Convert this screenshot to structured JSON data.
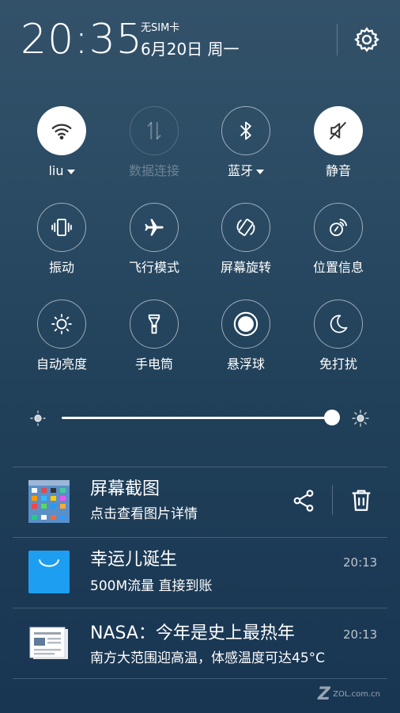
{
  "status": {
    "time": "20:35",
    "sim": "无SIM卡",
    "date": "6月20日 周一"
  },
  "toggles": [
    {
      "label": "liu",
      "icon": "wifi-icon",
      "state": "on",
      "dropdown": true
    },
    {
      "label": "数据连接",
      "icon": "mobile-data-icon",
      "state": "disabled",
      "dropdown": false
    },
    {
      "label": "蓝牙",
      "icon": "bluetooth-icon",
      "state": "off",
      "dropdown": true
    },
    {
      "label": "静音",
      "icon": "mute-icon",
      "state": "on",
      "dropdown": false
    },
    {
      "label": "振动",
      "icon": "vibrate-icon",
      "state": "off"
    },
    {
      "label": "飞行模式",
      "icon": "airplane-icon",
      "state": "off"
    },
    {
      "label": "屏幕旋转",
      "icon": "rotate-icon",
      "state": "off"
    },
    {
      "label": "位置信息",
      "icon": "location-icon",
      "state": "off"
    },
    {
      "label": "自动亮度",
      "icon": "brightness-icon",
      "state": "off"
    },
    {
      "label": "手电筒",
      "icon": "flashlight-icon",
      "state": "off"
    },
    {
      "label": "悬浮球",
      "icon": "floating-ball-icon",
      "state": "off"
    },
    {
      "label": "免打扰",
      "icon": "moon-icon",
      "state": "off"
    }
  ],
  "brightness": {
    "level": 1.0
  },
  "notifications": [
    {
      "title": "屏幕截图",
      "text": "点击查看图片详情",
      "time": "",
      "icon": "screenshot-thumbnail"
    },
    {
      "title": "幸运儿诞生",
      "text": "500M流量 直接到账",
      "time": "20:13",
      "icon": "shopping-bag-icon"
    },
    {
      "title": "NASA：今年是史上最热年",
      "text": "南方大范围迎高温，体感温度可达45°C",
      "time": "20:13",
      "icon": "news-icon"
    }
  ],
  "watermark": "ZOL.com.cn"
}
